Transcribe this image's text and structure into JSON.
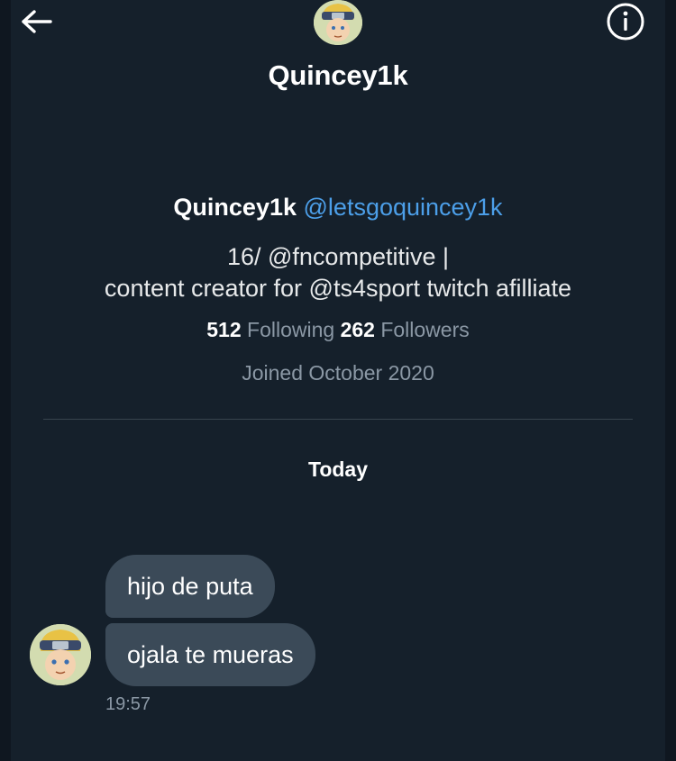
{
  "header": {
    "title": "Quincey1k",
    "back_icon": "arrow-left-icon",
    "info_icon": "info-circle-icon"
  },
  "profile": {
    "name": "Quincey1k",
    "handle": "@letsgoquincey1k",
    "bio_line1": "16/ @fncompetitive |",
    "bio_line2": "content creator for @ts4sport   twitch afilliate",
    "following_count": "512",
    "following_label": "Following",
    "followers_count": "262",
    "followers_label": "Followers",
    "joined": "Joined October 2020"
  },
  "conversation": {
    "day_label": "Today",
    "messages": [
      {
        "text": "hijo de puta"
      },
      {
        "text": "ojala te mueras"
      }
    ],
    "timestamp": "19:57"
  },
  "colors": {
    "background": "#15202b",
    "bubble": "#3b4a58",
    "handle": "#4c9fe9",
    "muted": "#8b98a5",
    "divider": "#38444d"
  }
}
